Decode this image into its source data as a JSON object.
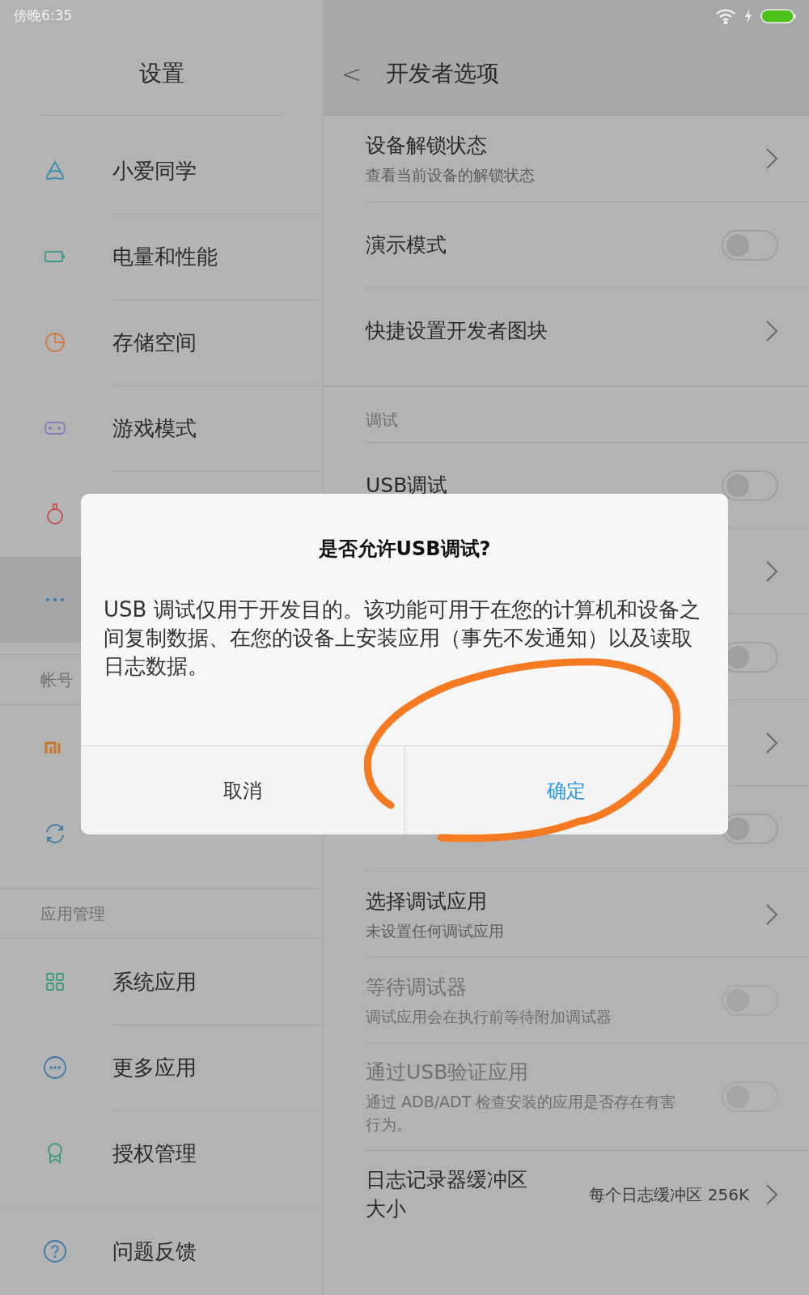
{
  "status_bar": {
    "time": "傍晚6:35"
  },
  "sidebar": {
    "title": "设置",
    "sections": [
      {
        "items": [
          {
            "label": "小爱同学",
            "selected": false
          },
          {
            "label": "电量和性能",
            "selected": false
          },
          {
            "label": "存储空间",
            "selected": false
          },
          {
            "label": "游戏模式",
            "selected": false
          },
          {
            "selected": false
          },
          {
            "selected": true
          }
        ]
      },
      {
        "header": "帐号",
        "items": [
          {
            "selected": false
          },
          {
            "selected": false
          }
        ]
      },
      {
        "header": "应用管理",
        "items": [
          {
            "label": "系统应用",
            "selected": false
          },
          {
            "label": "更多应用",
            "selected": false
          },
          {
            "label": "授权管理",
            "selected": false
          }
        ]
      },
      {
        "items": [
          {
            "label": "问题反馈",
            "selected": false
          }
        ]
      }
    ]
  },
  "page": {
    "back": "<",
    "title": "开发者选项",
    "sections": [
      {
        "rows": [
          {
            "kind": "chevron",
            "title": "设备解锁状态",
            "subtitle": "查看当前设备的解锁状态",
            "disabled": false
          },
          {
            "kind": "toggle",
            "title": "演示模式",
            "on": false,
            "disabled": false
          },
          {
            "kind": "chevron",
            "title": "快捷设置开发者图块",
            "disabled": false
          }
        ]
      },
      {
        "header": "调试",
        "rows": [
          {
            "kind": "toggle",
            "title": "USB调试",
            "on": false,
            "disabled": false
          },
          {
            "kind": "chevron",
            "disabled": false
          },
          {
            "kind": "toggle",
            "on": false
          },
          {
            "kind": "chevron",
            "disabled": false
          },
          {
            "kind": "toggle",
            "on": false
          },
          {
            "kind": "chevron",
            "title": "选择调试应用",
            "subtitle": "未设置任何调试应用",
            "disabled": false
          },
          {
            "kind": "toggle",
            "title": "等待调试器",
            "subtitle": "调试应用会在执行前等待附加调试器",
            "on": false,
            "disabled": true
          },
          {
            "kind": "toggle",
            "title": "通过USB验证应用",
            "subtitle": "通过 ADB/ADT 检查安装的应用是否存在有害行为。",
            "on": false,
            "disabled": true
          },
          {
            "kind": "chevron",
            "title": "日志记录器缓冲区大小",
            "value": "每个日志缓冲区 256K",
            "disabled": false
          }
        ]
      }
    ]
  },
  "dialog": {
    "title": "是否允许USB调试?",
    "message": "USB 调试仅用于开发目的。该功能可用于在您的计算机和设备之间复制数据、在您的设备上安装应用（事先不发通知）以及读取日志数据。",
    "buttons": [
      {
        "label": "取消",
        "primary": false
      },
      {
        "label": "确定",
        "primary": true
      }
    ]
  }
}
